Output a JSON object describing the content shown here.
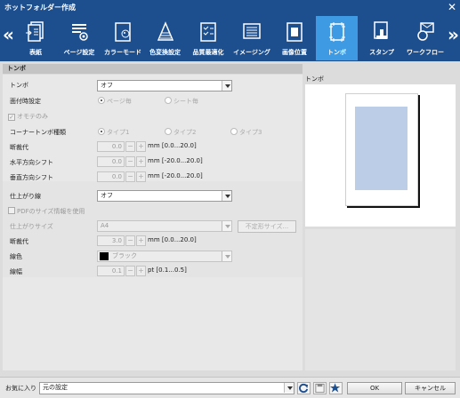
{
  "window": {
    "title": "ホットフォルダー作成",
    "close_glyph": "✕"
  },
  "toolbar": {
    "prev_glyph": "«",
    "next_glyph": "»",
    "tools": [
      {
        "label": "表紙",
        "icon": "cover-icon",
        "active": false
      },
      {
        "label": "ページ設定",
        "icon": "page-setup-icon",
        "active": false
      },
      {
        "label": "カラーモード",
        "icon": "color-mode-icon",
        "active": false
      },
      {
        "label": "色変換設定",
        "icon": "color-conversion-icon",
        "active": false
      },
      {
        "label": "品質最適化",
        "icon": "quality-icon",
        "active": false
      },
      {
        "label": "イメージング",
        "icon": "imaging-icon",
        "active": false
      },
      {
        "label": "画像位置",
        "icon": "image-position-icon",
        "active": false
      },
      {
        "label": "トンボ",
        "icon": "trim-marks-icon",
        "active": true
      },
      {
        "label": "スタンプ",
        "icon": "stamp-icon",
        "active": false
      },
      {
        "label": "ワークフロー",
        "icon": "workflow-icon",
        "active": false
      }
    ]
  },
  "section": {
    "title": "トンボ"
  },
  "form": {
    "tombo": {
      "label": "トンボ",
      "value": "オフ"
    },
    "sides": {
      "label": "面付時設定",
      "option1": "ページ毎",
      "option2": "シート毎",
      "selected": "ページ毎"
    },
    "front_only": {
      "label": "オモテのみ",
      "checked": true
    },
    "corner_type": {
      "label": "コーナートンボ種類",
      "option1": "タイプ1",
      "option2": "タイプ2",
      "option3": "タイプ3",
      "selected": "タイプ1"
    },
    "bleed": {
      "label": "断裁代",
      "value": "0.0",
      "range": "mm [0.0...20.0]"
    },
    "h_shift": {
      "label": "水平方向シフト",
      "value": "0.0",
      "range": "mm [-20.0...20.0]"
    },
    "v_shift": {
      "label": "垂直方向シフト",
      "value": "0.0",
      "range": "mm [-20.0...20.0]"
    },
    "finish_line": {
      "label": "仕上がり線",
      "value": "オフ"
    },
    "use_pdf_size": {
      "label": "PDFのサイズ情報を使用",
      "checked": false
    },
    "finish_size": {
      "label": "仕上がりサイズ",
      "value": "A4",
      "custom_button": "不定形サイズ..."
    },
    "finish_bleed": {
      "label": "断裁代",
      "value": "3.0",
      "range": "mm [0.0...20.0]"
    },
    "line_color": {
      "label": "線色",
      "value": "ブラック",
      "swatch": "#000000"
    },
    "line_width": {
      "label": "線幅",
      "value": "0.1",
      "range": "pt [0.1...0.5]"
    },
    "spin_minus": "−",
    "spin_plus": "+"
  },
  "preview": {
    "title": "トンボ"
  },
  "bottom": {
    "favorites_label": "お気に入り",
    "favorites_value": "元の設定",
    "ok_label": "OK",
    "cancel_label": "キャンセル"
  },
  "colors": {
    "toolbar_bg": "#1d4f8e",
    "active_tab": "#3d9ae3",
    "image_area": "#bccde8"
  }
}
